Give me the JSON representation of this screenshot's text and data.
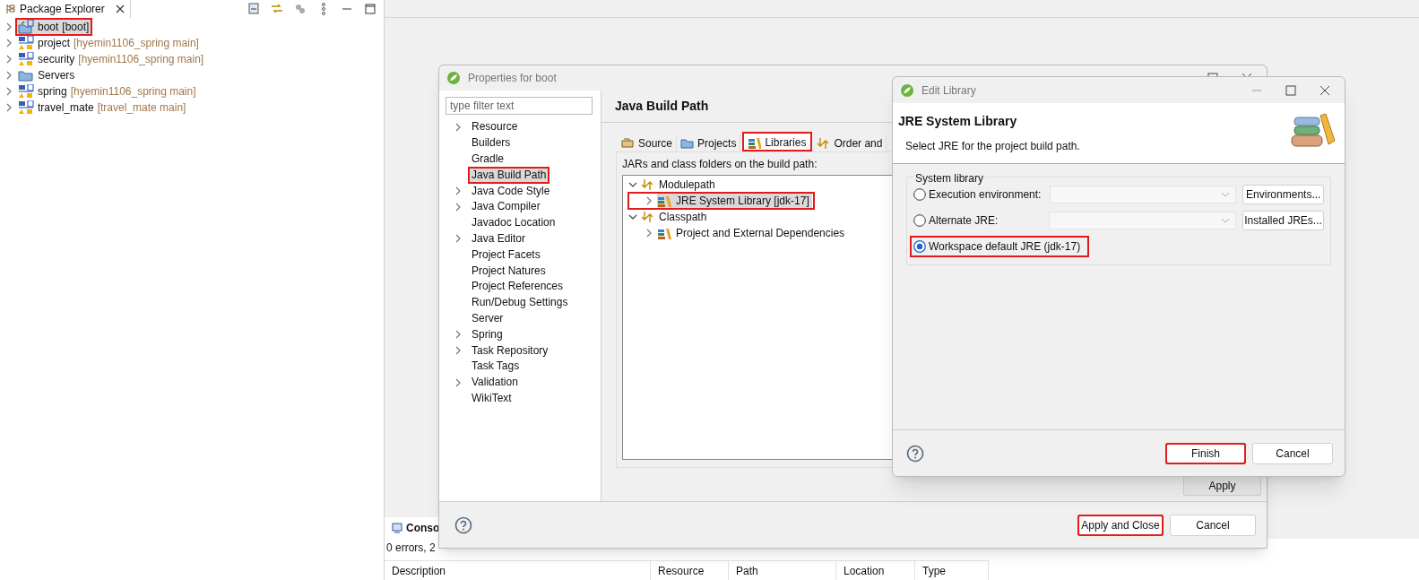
{
  "package_explorer": {
    "title": "Package Explorer",
    "projects": [
      {
        "name": "boot",
        "repo": "[boot]",
        "kind": "spring",
        "selected": true,
        "highlighted": true
      },
      {
        "name": "project",
        "repo": "[hyemin1106_spring main]",
        "kind": "maven",
        "selected": false,
        "highlighted": false
      },
      {
        "name": "security",
        "repo": "[hyemin1106_spring main]",
        "kind": "maven",
        "selected": false,
        "highlighted": false
      },
      {
        "name": "Servers",
        "kind": "folder",
        "selected": false,
        "highlighted": false
      },
      {
        "name": "spring",
        "repo": "[hyemin1106_spring main]",
        "kind": "maven",
        "selected": false,
        "highlighted": false
      },
      {
        "name": "travel_mate",
        "repo": "[travel_mate main]",
        "kind": "maven",
        "selected": false,
        "highlighted": false
      }
    ]
  },
  "properties_dialog": {
    "title": "Properties for boot",
    "filter": {
      "placeholder": "type filter text"
    },
    "nav": [
      {
        "label": "Resource",
        "expandable": true,
        "selected": false,
        "highlighted": false
      },
      {
        "label": "Builders",
        "expandable": false,
        "selected": false,
        "highlighted": false
      },
      {
        "label": "Gradle",
        "expandable": false,
        "selected": false,
        "highlighted": false
      },
      {
        "label": "Java Build Path",
        "expandable": false,
        "selected": true,
        "highlighted": true
      },
      {
        "label": "Java Code Style",
        "expandable": true,
        "selected": false,
        "highlighted": false
      },
      {
        "label": "Java Compiler",
        "expandable": true,
        "selected": false,
        "highlighted": false
      },
      {
        "label": "Javadoc Location",
        "expandable": false,
        "selected": false,
        "highlighted": false
      },
      {
        "label": "Java Editor",
        "expandable": true,
        "selected": false,
        "highlighted": false
      },
      {
        "label": "Project Facets",
        "expandable": false,
        "selected": false,
        "highlighted": false
      },
      {
        "label": "Project Natures",
        "expandable": false,
        "selected": false,
        "highlighted": false
      },
      {
        "label": "Project References",
        "expandable": false,
        "selected": false,
        "highlighted": false
      },
      {
        "label": "Run/Debug Settings",
        "expandable": false,
        "selected": false,
        "highlighted": false
      },
      {
        "label": "Server",
        "expandable": false,
        "selected": false,
        "highlighted": false
      },
      {
        "label": "Spring",
        "expandable": true,
        "selected": false,
        "highlighted": false
      },
      {
        "label": "Task Repository",
        "expandable": true,
        "selected": false,
        "highlighted": false
      },
      {
        "label": "Task Tags",
        "expandable": false,
        "selected": false,
        "highlighted": false
      },
      {
        "label": "Validation",
        "expandable": true,
        "selected": false,
        "highlighted": false
      },
      {
        "label": "WikiText",
        "expandable": false,
        "selected": false,
        "highlighted": false
      }
    ],
    "page_title": "Java Build Path",
    "tabs": [
      {
        "label": "Source",
        "kind": "source",
        "selected": false,
        "highlighted": false
      },
      {
        "label": "Projects",
        "kind": "projects",
        "selected": false,
        "highlighted": false
      },
      {
        "label": "Libraries",
        "kind": "libraries",
        "selected": true,
        "highlighted": true
      },
      {
        "label": "Order and",
        "kind": "order",
        "selected": false,
        "highlighted": false
      }
    ],
    "build_path_label": "JARs and class folders on the build path:",
    "tree": [
      {
        "label": "Modulepath",
        "expanded": true,
        "children": [
          {
            "label": "JRE System Library [jdk-17]",
            "expanded": false,
            "selected": true,
            "highlighted": true
          }
        ]
      },
      {
        "label": "Classpath",
        "expanded": true,
        "children": [
          {
            "label": "Project and External Dependencies",
            "expanded": false,
            "selected": false,
            "highlighted": false
          }
        ]
      }
    ],
    "apply": "Apply",
    "buttons": [
      {
        "label": "Apply and Close",
        "default": true,
        "highlighted": true
      },
      {
        "label": "Cancel",
        "default": false,
        "highlighted": false
      }
    ]
  },
  "edit_library": {
    "title": "Edit Library",
    "header_title": "JRE System Library",
    "header_subtitle": "Select JRE for the project build path.",
    "group_label": "System library",
    "options": [
      {
        "label": "Execution environment:",
        "selected": false,
        "highlighted": false,
        "button": "Environments..."
      },
      {
        "label": "Alternate JRE:",
        "selected": false,
        "highlighted": false,
        "button": "Installed JREs..."
      },
      {
        "label": "Workspace default JRE (jdk-17)",
        "selected": true,
        "highlighted": true
      }
    ],
    "buttons": [
      {
        "label": "Finish",
        "default": true,
        "highlighted": true
      },
      {
        "label": "Cancel",
        "default": false,
        "highlighted": false
      }
    ]
  },
  "problems": {
    "tab": "Conso",
    "summary": "0 errors, 2",
    "columns": [
      "Description",
      "Resource",
      "Path",
      "Location",
      "Type"
    ]
  }
}
